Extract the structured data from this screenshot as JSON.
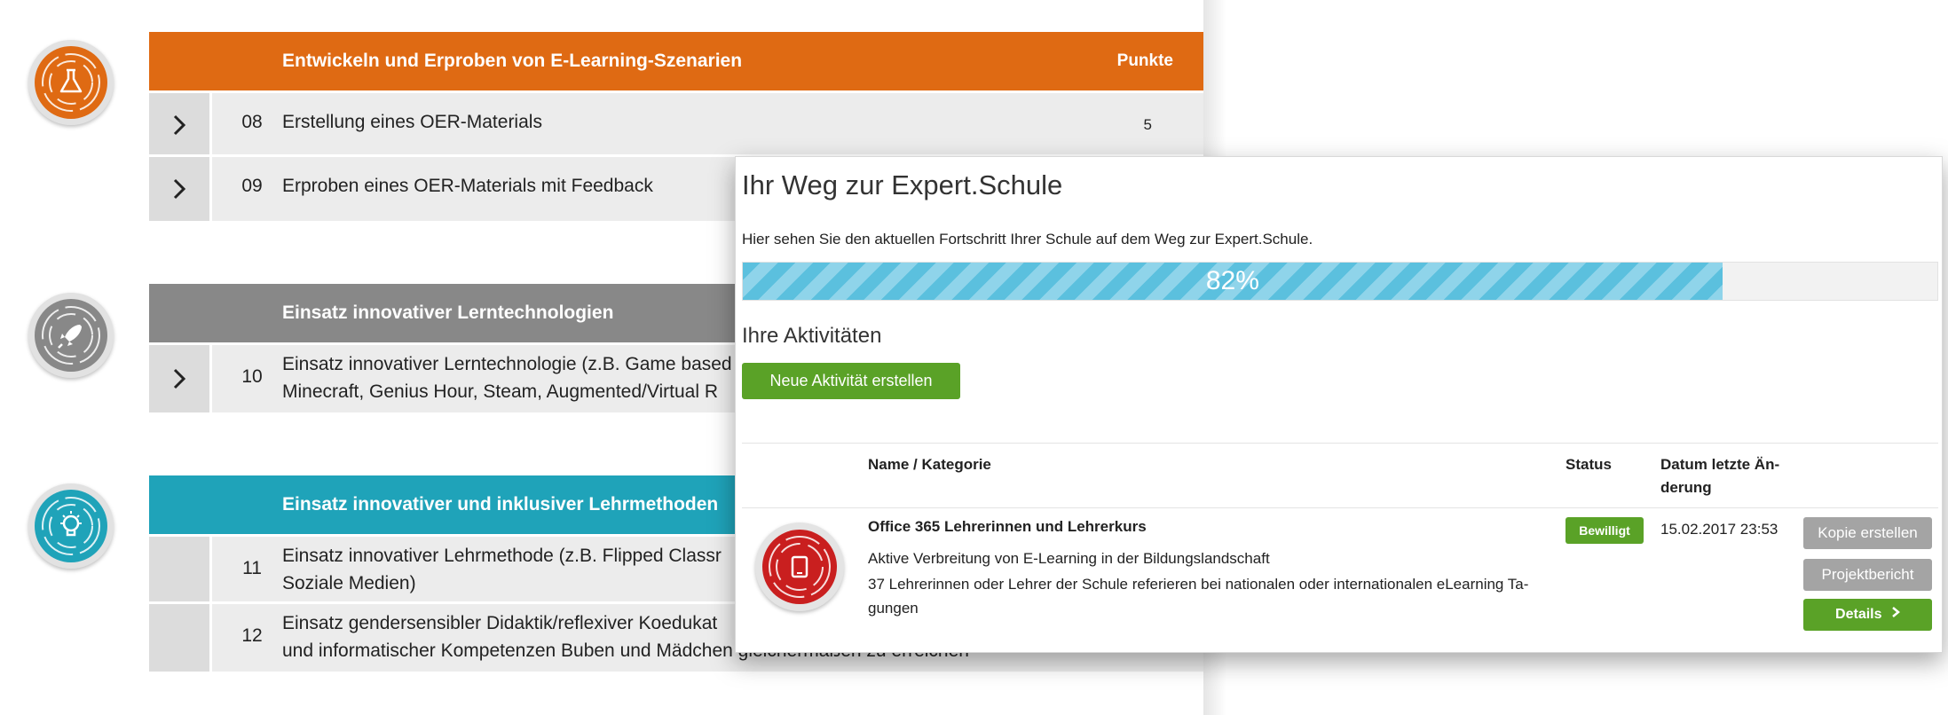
{
  "sections": [
    {
      "title": "Entwickeln und Erproben von E-Learning-Szenarien",
      "points_header": "Punkte",
      "color": "#df6a13",
      "icon": "flask-icon",
      "rows": [
        {
          "num": "08",
          "label": "Erstellung eines OER-Materials",
          "points": "5"
        },
        {
          "num": "09",
          "label": "Erproben eines OER-Materials mit Feedback",
          "points": ""
        }
      ]
    },
    {
      "title": "Einsatz innovativer Lerntechnologien",
      "color": "#888888",
      "icon": "rocket-icon",
      "rows": [
        {
          "num": "10",
          "label_line1": "Einsatz innovativer Lerntechnologie (z.B. Game based",
          "label_line2": "Minecraft, Genius Hour, Steam, Augmented/Virtual R"
        }
      ]
    },
    {
      "title": "Einsatz innovativer und inklusiver Lehrmethoden",
      "color": "#1fa3b9",
      "icon": "lightbulb-icon",
      "rows": [
        {
          "num": "11",
          "label_line1": "Einsatz innovativer Lehrmethode (z.B. Flipped Classr",
          "label_line2": "Soziale Medien)"
        },
        {
          "num": "12",
          "label_line1": "Einsatz gendersensibler Didaktik/reflexiver Koedukat",
          "label_line2": "und informatischer Kompetenzen Buben und Mädchen gleichermaßen zu erreichen"
        }
      ]
    }
  ],
  "progress_panel": {
    "title": "Ihr Weg zur Expert.Schule",
    "subtitle": "Hier sehen Sie den aktuellen Fortschritt Ihrer Schule auf dem Weg zur Expert.Schule.",
    "progress_label": "82%",
    "progress_value": 0.82,
    "activities_heading": "Ihre Aktivitäten",
    "new_activity_button": "Neue Aktivität erstellen",
    "table": {
      "col_name": "Name / Kategorie",
      "col_status": "Status",
      "col_date_line1": "Datum letzte Än-",
      "col_date_line2": "derung"
    },
    "activity": {
      "icon": "tablet-icon",
      "name": "Office 365 Lehrerinnen und Lehrerkurs",
      "category": "Aktive Verbreitung von E-Learning in der Bildungslandschaft",
      "description_line1": "37 Lehrerinnen oder Lehrer der Schule referieren bei nationalen oder internationalen eLearning Ta-",
      "description_line2": "gungen",
      "status": "Bewilligt",
      "date": "15.02.2017 23:53",
      "copy_button": "Kopie erstellen",
      "report_button": "Projektbericht",
      "details_button": "Details"
    }
  },
  "colors": {
    "orange": "#df6a13",
    "grey": "#888888",
    "teal": "#1fa3b9",
    "green": "#5aa227",
    "progress_blue": "#5bc0de",
    "red": "#c91f1f"
  }
}
